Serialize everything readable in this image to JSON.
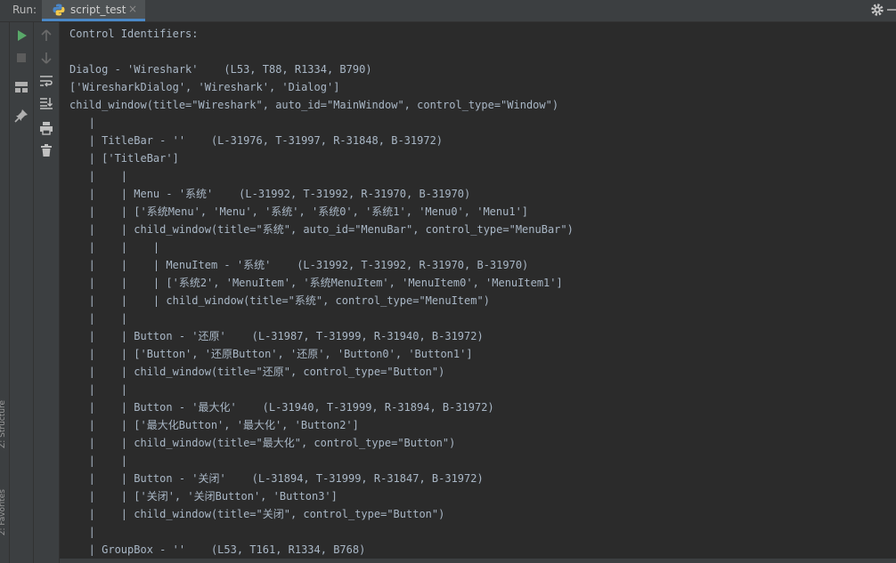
{
  "run_panel": {
    "label": "Run:",
    "tab": {
      "title": "script_test",
      "close": "×"
    }
  },
  "side_labels": [
    "Z: Structure",
    "2: Favorites"
  ],
  "console_lines": [
    "Control Identifiers:",
    "",
    "Dialog - 'Wireshark'    (L53, T88, R1334, B790)",
    "['WiresharkDialog', 'Wireshark', 'Dialog']",
    "child_window(title=\"Wireshark\", auto_id=\"MainWindow\", control_type=\"Window\")",
    "   |",
    "   | TitleBar - ''    (L-31976, T-31997, R-31848, B-31972)",
    "   | ['TitleBar']",
    "   |    |",
    "   |    | Menu - '系统'    (L-31992, T-31992, R-31970, B-31970)",
    "   |    | ['系统Menu', 'Menu', '系统', '系统0', '系统1', 'Menu0', 'Menu1']",
    "   |    | child_window(title=\"系统\", auto_id=\"MenuBar\", control_type=\"MenuBar\")",
    "   |    |    |",
    "   |    |    | MenuItem - '系统'    (L-31992, T-31992, R-31970, B-31970)",
    "   |    |    | ['系统2', 'MenuItem', '系统MenuItem', 'MenuItem0', 'MenuItem1']",
    "   |    |    | child_window(title=\"系统\", control_type=\"MenuItem\")",
    "   |    |",
    "   |    | Button - '还原'    (L-31987, T-31999, R-31940, B-31972)",
    "   |    | ['Button', '还原Button', '还原', 'Button0', 'Button1']",
    "   |    | child_window(title=\"还原\", control_type=\"Button\")",
    "   |    |",
    "   |    | Button - '最大化'    (L-31940, T-31999, R-31894, B-31972)",
    "   |    | ['最大化Button', '最大化', 'Button2']",
    "   |    | child_window(title=\"最大化\", control_type=\"Button\")",
    "   |    |",
    "   |    | Button - '关闭'    (L-31894, T-31999, R-31847, B-31972)",
    "   |    | ['关闭', '关闭Button', 'Button3']",
    "   |    | child_window(title=\"关闭\", control_type=\"Button\")",
    "   |",
    "   | GroupBox - ''    (L53, T161, R1334, B768)"
  ],
  "icons": {
    "toolbar_left": [
      "run-icon",
      "stop-icon",
      "layout-icon",
      "pin-icon"
    ],
    "toolbar_right": [
      "up-arrow-icon",
      "down-arrow-icon",
      "soft-wrap-icon",
      "scroll-to-end-icon",
      "print-icon",
      "trash-icon"
    ],
    "tab": "python-icon",
    "top_right": "gear-icon"
  },
  "colors": {
    "background": "#2b2b2b",
    "panel": "#3c3f41",
    "text": "#a9b7c6",
    "run_green": "#59a869",
    "tab_underline": "#4a88c7"
  }
}
